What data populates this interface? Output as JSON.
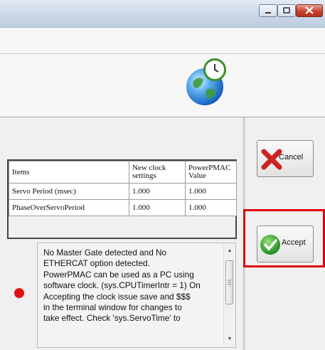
{
  "window": {
    "controls": {
      "minimize": "minimize-icon",
      "maximize": "maximize-icon",
      "close": "close-icon"
    }
  },
  "table": {
    "headers": [
      "Items",
      "New clock settings",
      "PowerPMAC Value"
    ],
    "rows": [
      [
        "Servo Period (msec)",
        "1.000",
        "1.000"
      ],
      [
        "PhaseOverServoPeriod",
        "1.000",
        "1.000"
      ]
    ]
  },
  "message": {
    "text": "No Master Gate detected and No\nETHERCAT option detected.\nPowerPMAC can be used as a PC using\nsoftware clock. (sys.CPUTimerIntr = 1) On\nAccepting the clock issue save and $$$\nin the terminal window for changes to\ntake effect. Check 'sys.ServoTime' to",
    "status_color": "#e01010"
  },
  "buttons": {
    "cancel_label": "Cancel",
    "accept_label": "Accept"
  },
  "highlight_color": "#e0000e"
}
